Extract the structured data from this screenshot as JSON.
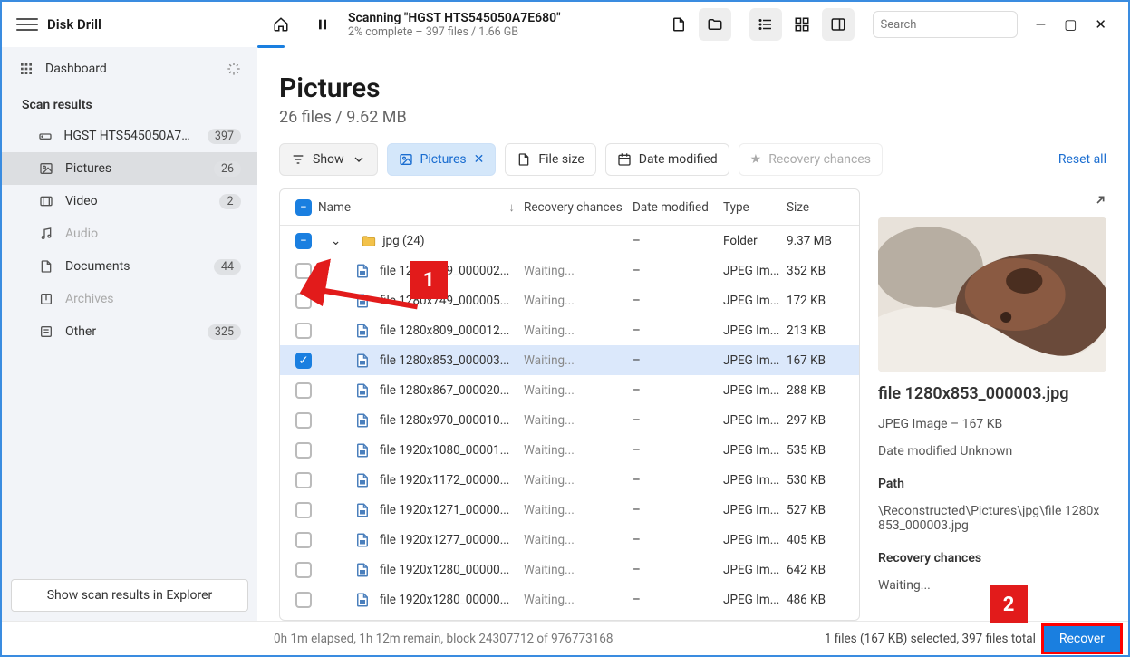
{
  "app": {
    "title": "Disk Drill"
  },
  "scan": {
    "title": "Scanning \"HGST HTS545050A7E680\"",
    "subtitle": "2% complete – 397 files / 1.66 GB"
  },
  "search": {
    "placeholder": "Search"
  },
  "sidebar": {
    "dashboard": "Dashboard",
    "scan_results_heading": "Scan results",
    "drive": {
      "label": "HGST HTS545050A7E680",
      "count": "397"
    },
    "categories": [
      {
        "label": "Pictures",
        "count": "26"
      },
      {
        "label": "Video",
        "count": "2"
      },
      {
        "label": "Audio",
        "count": ""
      },
      {
        "label": "Documents",
        "count": "44"
      },
      {
        "label": "Archives",
        "count": ""
      },
      {
        "label": "Other",
        "count": "325"
      }
    ],
    "explorer_button": "Show scan results in Explorer"
  },
  "page": {
    "title": "Pictures",
    "subtitle": "26 files / 9.62 MB"
  },
  "filters": {
    "show": "Show",
    "chip_pictures": "Pictures",
    "file_size": "File size",
    "date_modified": "Date modified",
    "recovery_chances": "Recovery chances",
    "reset": "Reset all"
  },
  "columns": {
    "name": "Name",
    "recovery": "Recovery chances",
    "date": "Date modified",
    "type": "Type",
    "size": "Size"
  },
  "folder_row": {
    "label": "jpg (24)",
    "type": "Folder",
    "size": "9.37 MB",
    "date": "–"
  },
  "files": [
    {
      "name": "file 1280x749_000002...",
      "rec": "Waiting...",
      "date": "–",
      "type": "JPEG Im...",
      "size": "352 KB"
    },
    {
      "name": "file 1280x749_000005...",
      "rec": "Waiting...",
      "date": "–",
      "type": "JPEG Im...",
      "size": "172 KB"
    },
    {
      "name": "file 1280x809_000012...",
      "rec": "Waiting...",
      "date": "–",
      "type": "JPEG Im...",
      "size": "213 KB"
    },
    {
      "name": "file 1280x853_000003...",
      "rec": "Waiting...",
      "date": "–",
      "type": "JPEG Im...",
      "size": "167 KB"
    },
    {
      "name": "file 1280x867_000020...",
      "rec": "Waiting...",
      "date": "–",
      "type": "JPEG Im...",
      "size": "288 KB"
    },
    {
      "name": "file 1280x970_000010...",
      "rec": "Waiting...",
      "date": "–",
      "type": "JPEG Im...",
      "size": "297 KB"
    },
    {
      "name": "file 1920x1080_00001...",
      "rec": "Waiting...",
      "date": "–",
      "type": "JPEG Im...",
      "size": "535 KB"
    },
    {
      "name": "file 1920x1172_00000...",
      "rec": "Waiting...",
      "date": "–",
      "type": "JPEG Im...",
      "size": "530 KB"
    },
    {
      "name": "file 1920x1271_00000...",
      "rec": "Waiting...",
      "date": "–",
      "type": "JPEG Im...",
      "size": "527 KB"
    },
    {
      "name": "file 1920x1277_00000...",
      "rec": "Waiting...",
      "date": "–",
      "type": "JPEG Im...",
      "size": "405 KB"
    },
    {
      "name": "file 1920x1280_00000...",
      "rec": "Waiting...",
      "date": "–",
      "type": "JPEG Im...",
      "size": "642 KB"
    },
    {
      "name": "file 1920x1280_00000...",
      "rec": "Waiting...",
      "date": "–",
      "type": "JPEG Im...",
      "size": "486 KB"
    }
  ],
  "selected_index": 3,
  "preview": {
    "title": "file 1280x853_000003.jpg",
    "meta": "JPEG Image – 167 KB",
    "date": "Date modified Unknown",
    "path_label": "Path",
    "path_value": "\\Reconstructed\\Pictures\\jpg\\file 1280x853_000003.jpg",
    "rc_label": "Recovery chances",
    "rc_value": "Waiting..."
  },
  "statusbar": {
    "elapsed": "0h 1m elapsed, 1h 12m remain, block 24307712 of 976773168",
    "selected": "1 files (167 KB) selected, 397 files total",
    "recover": "Recover"
  },
  "annotations": {
    "a1": "1",
    "a2": "2"
  }
}
